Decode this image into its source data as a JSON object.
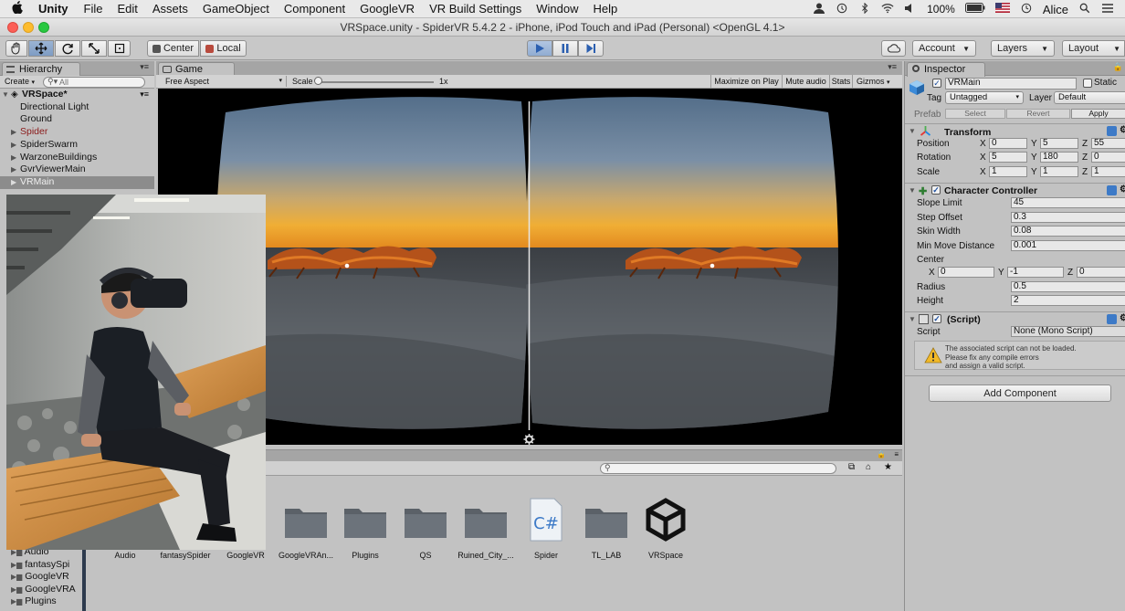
{
  "menubar": {
    "app_name": "Unity",
    "menus": [
      "File",
      "Edit",
      "Assets",
      "GameObject",
      "Component",
      "GoogleVR",
      "VR Build Settings",
      "Window",
      "Help"
    ],
    "battery": "100%",
    "user": "Alice"
  },
  "window": {
    "title": "VRSpace.unity - SpiderVR 5.4.2 2 - iPhone, iPod Touch and iPad (Personal) <OpenGL 4.1>"
  },
  "toolbar": {
    "pivot_label": "Center",
    "space_label": "Local",
    "account_label": "Account",
    "layers_label": "Layers",
    "layout_label": "Layout"
  },
  "hierarchy": {
    "tab_label": "Hierarchy",
    "create_label": "Create",
    "search_placeholder": "All",
    "scene_name": "VRSpace*",
    "items": [
      {
        "label": "Directional Light"
      },
      {
        "label": "Ground"
      },
      {
        "label": "Spider"
      },
      {
        "label": "SpiderSwarm"
      },
      {
        "label": "WarzoneBuildings"
      },
      {
        "label": "GvrViewerMain"
      },
      {
        "label": "VRMain"
      }
    ]
  },
  "game": {
    "tab_label": "Game",
    "aspect": "Free Aspect",
    "scale_label": "Scale",
    "scale_value": "1x",
    "maximize_label": "Maximize on Play",
    "mute_label": "Mute audio",
    "stats_label": "Stats",
    "gizmos_label": "Gizmos"
  },
  "inspector": {
    "tab_label": "Inspector",
    "object_name": "VRMain",
    "static_label": "Static",
    "tag_label": "Tag",
    "tag_value": "Untagged",
    "layer_label": "Layer",
    "layer_value": "Default",
    "prefab_label": "Prefab",
    "select_label": "Select",
    "revert_label": "Revert",
    "apply_label": "Apply",
    "transform": {
      "title": "Transform",
      "position_label": "Position",
      "rotation_label": "Rotation",
      "scale_label": "Scale",
      "position": {
        "x": "0",
        "y": "5",
        "z": "55"
      },
      "rotation": {
        "x": "5",
        "y": "180",
        "z": "0"
      },
      "scale": {
        "x": "1",
        "y": "1",
        "z": "1"
      }
    },
    "character_controller": {
      "title": "Character Controller",
      "slope_limit_label": "Slope Limit",
      "slope_limit": "45",
      "step_offset_label": "Step Offset",
      "step_offset": "0.3",
      "skin_width_label": "Skin Width",
      "skin_width": "0.08",
      "min_move_label": "Min Move Distance",
      "min_move": "0.001",
      "center_label": "Center",
      "center": {
        "x": "0",
        "y": "-1",
        "z": "0"
      },
      "radius_label": "Radius",
      "radius": "0.5",
      "height_label": "Height",
      "height": "2"
    },
    "script": {
      "title": "(Script)",
      "script_label": "Script",
      "script_value": "None (Mono Script)",
      "warning_line1": "The associated script can not be loaded.",
      "warning_line2": "Please fix any compile errors",
      "warning_line3": "and assign a valid script."
    },
    "add_component_label": "Add Component"
  },
  "project": {
    "folders": [
      {
        "name": "Audio"
      },
      {
        "name": "fantasySpider"
      },
      {
        "name": "GoogleVR"
      },
      {
        "name": "GoogleVRAn..."
      },
      {
        "name": "Plugins"
      },
      {
        "name": "QS"
      },
      {
        "name": "Ruined_City_..."
      },
      {
        "name": "Spider"
      },
      {
        "name": "TL_LAB"
      },
      {
        "name": "VRSpace"
      }
    ],
    "tree": [
      {
        "label": "Audio"
      },
      {
        "label": "fantasySpi"
      },
      {
        "label": "GoogleVR"
      },
      {
        "label": "GoogleVRA"
      },
      {
        "label": "Plugins"
      }
    ]
  },
  "colors": {
    "unity_gray": "#c2c2c2",
    "selection": "#8c8c8c",
    "prefab_red": "#8b1a1a",
    "play_blue": "#3b6db5"
  }
}
